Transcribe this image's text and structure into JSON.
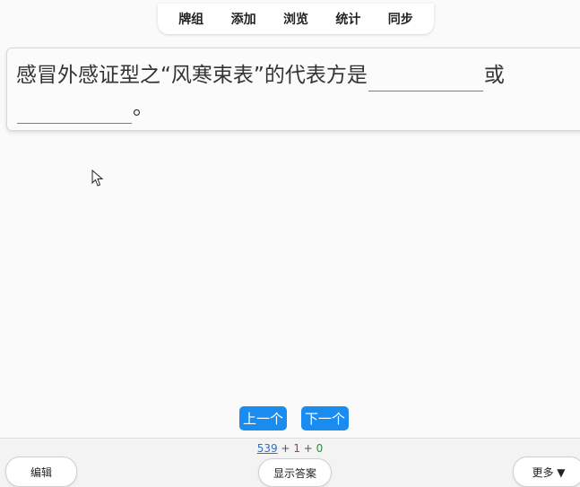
{
  "nav": {
    "items": [
      "牌组",
      "添加",
      "浏览",
      "统计",
      "同步"
    ]
  },
  "card": {
    "text_before": "感冒外感证型之“风寒束表”的代表方是",
    "text_or": "或",
    "text_end": "。"
  },
  "buttons": {
    "prev": "上一个",
    "next": "下一个"
  },
  "bottom": {
    "count_new": "539",
    "count_learn": "1",
    "count_review": "0",
    "plus": "+",
    "edit": "编辑",
    "show_answer": "显示答案",
    "more": "更多 ▼"
  },
  "colors": {
    "accent": "#1a8cf0",
    "cloze_line": "#3a8fd8",
    "new_count": "#2a6fd8",
    "learn_count": "#c0392b",
    "review_count": "#2e8b3a"
  }
}
